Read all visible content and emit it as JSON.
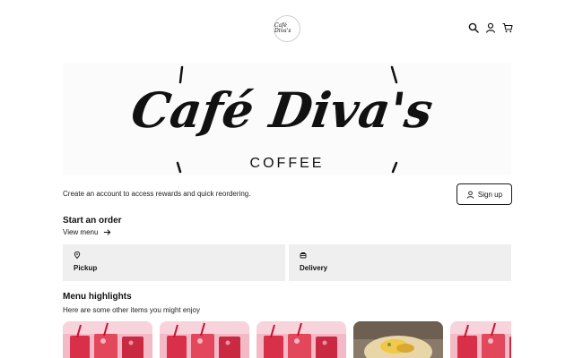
{
  "header": {
    "logo_text": "Café Diva's",
    "icons": [
      "search-icon",
      "user-icon",
      "cart-icon"
    ]
  },
  "hero": {
    "brand_script": "Café Diva's",
    "brand_sub": "COFFEE"
  },
  "account": {
    "prompt": "Create an account to access rewards and quick reordering.",
    "signup_label": "Sign up"
  },
  "order": {
    "title": "Start an order",
    "view_menu_label": "View menu",
    "options": [
      {
        "label": "Pickup",
        "icon": "location-pin-icon"
      },
      {
        "label": "Delivery",
        "icon": "delivery-icon"
      }
    ]
  },
  "highlights": {
    "title": "Menu highlights",
    "subtitle": "Here are some other items you might enjoy"
  },
  "colors": {
    "card_bg": "#efefef",
    "accent_dark": "#1a1a1a",
    "drink_red": "#d9304a",
    "drink_pink": "#f2a7b8"
  }
}
